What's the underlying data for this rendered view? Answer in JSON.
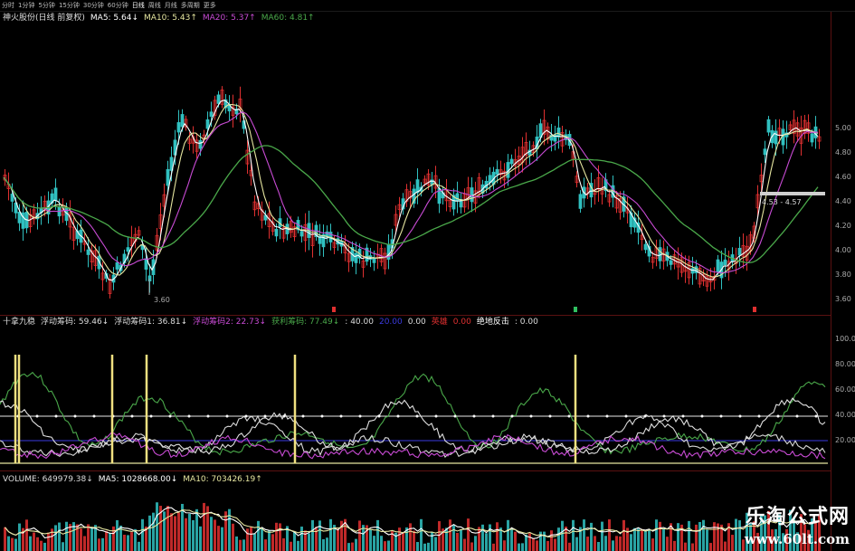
{
  "toolbar": [
    "分时",
    "1分钟",
    "5分钟",
    "15分钟",
    "30分钟",
    "60分钟",
    "日线",
    "周线",
    "月线",
    "多周期",
    "更多"
  ],
  "main": {
    "title": "神火股份(日线 前复权)",
    "ma5": "MA5: 5.64↓",
    "ma10": "MA10: 5.43↑",
    "ma20": "MA20: 5.37↑",
    "ma60": "MA60: 4.81↑",
    "low_label": "3.60",
    "range_label": "4.53 - 4.57",
    "axis_ticks": [
      "5.00",
      "4.80",
      "4.60",
      "4.40",
      "4.20",
      "4.00",
      "3.80",
      "3.60"
    ]
  },
  "indicator": {
    "name": "十拿九稳",
    "f1": "浮动筹码: 59.46↓",
    "f2": "浮动筹码1: 36.81↓",
    "f3": "浮动筹码2: 22.73↓",
    "f4": "获利筹码: 77.49↓",
    "v40": ": 40.00",
    "v20": "20.00",
    "v0": "0.00",
    "lbl_red": "英雄",
    "v0b": "0.00",
    "lbl_white": "绝地反击",
    "v0c": ": 0.00",
    "axis_ticks": [
      "100.0",
      "80.00",
      "60.00",
      "40.00",
      "20.00"
    ]
  },
  "volume": {
    "label": "VOLUME: 649979.38↓",
    "ma5": "MA5: 1028668.00↓",
    "ma10": "MA10: 703426.19↑"
  },
  "watermark": {
    "cn": "乐淘公式网",
    "url": "www.60lt.com"
  },
  "colors": {
    "ma5": "#ffffff",
    "ma10": "#e6e6a0",
    "ma20": "#c84bd4",
    "ma60": "#4aa84a",
    "up": "#e03030",
    "down": "#30c0c0"
  }
}
